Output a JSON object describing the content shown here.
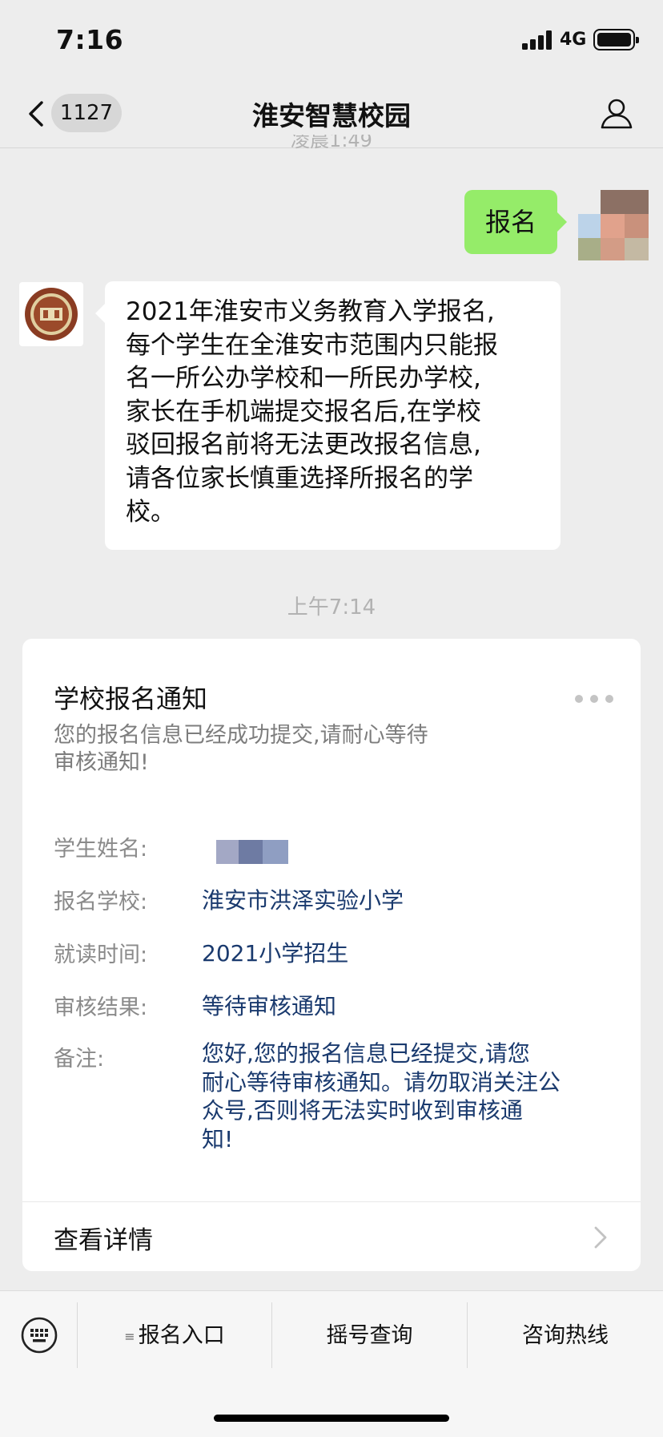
{
  "status": {
    "time": "7:16",
    "network": "4G"
  },
  "nav": {
    "back_badge": "1127",
    "title": "淮安智慧校园"
  },
  "chat": {
    "partial_timestamp": "凌晨1:49",
    "user_message": "报名",
    "official_lines": [
      "2021年淮安市义务教育入学报名,",
      "每个学生在全淮安市范围内只能报",
      "名一所公办学校和一所民办学校,",
      "家长在手机端提交报名后,在学校",
      "驳回报名前将无法更改报名信息,",
      "请各位家长慎重选择所报名的学",
      "校。"
    ],
    "timestamp": "上午7:14"
  },
  "card": {
    "title": "学校报名通知",
    "desc_lines": [
      "您的报名信息已经成功提交,请耐心等待",
      "审核通知!"
    ],
    "fields": [
      {
        "label": "学生姓名:",
        "value": ""
      },
      {
        "label": "报名学校:",
        "value": "淮安市洪泽实验小学"
      },
      {
        "label": "就读时间:",
        "value": "2021小学招生"
      },
      {
        "label": "审核结果:",
        "value": "等待审核通知"
      },
      {
        "label": "备注:",
        "value": ""
      }
    ],
    "note_lines": [
      "您好,您的报名信息已经提交,请您",
      "耐心等待审核通知。请勿取消关注公",
      "众号,否则将无法实时收到审核通",
      "知!"
    ],
    "detail_label": "查看详情"
  },
  "menu": {
    "items": [
      "报名入口",
      "摇号查询",
      "咨询热线"
    ],
    "menu_glyph": "≡"
  },
  "colors": {
    "background": "#ededed",
    "user_bubble": "#95ec69",
    "card_value": "#1a3a6e",
    "secondary_text": "#b2b2b2"
  },
  "icons": [
    "back-chevron-icon",
    "profile-icon",
    "more-dots-icon",
    "chevron-right-icon",
    "keyboard-icon",
    "menu-list-icon"
  ]
}
